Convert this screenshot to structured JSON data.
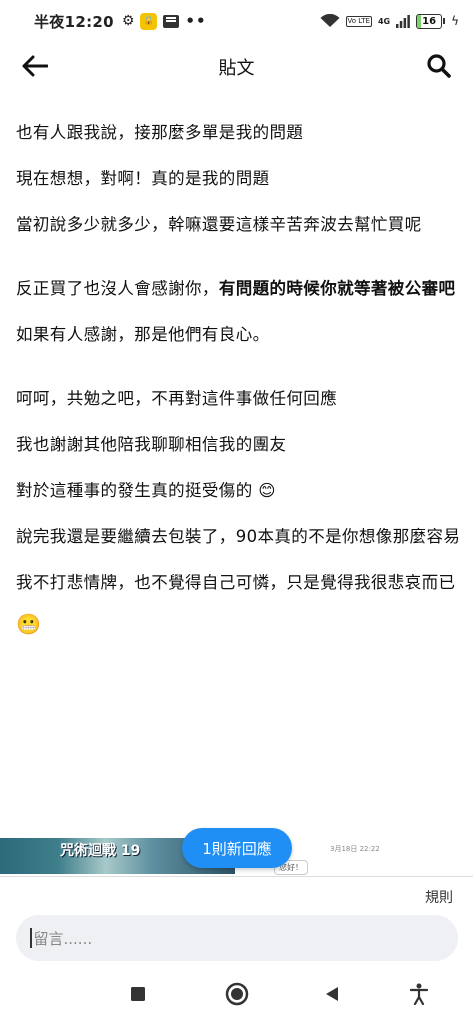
{
  "status_bar": {
    "time": "半夜12:20",
    "network": "4G",
    "lte": "Vo LTE",
    "battery": "16",
    "battery_level": 0.16,
    "more": "••"
  },
  "header": {
    "title": "貼文"
  },
  "post": {
    "p1": "也有人跟我說，接那麼多單是我的問題",
    "p2": "現在想想，對啊！真的是我的問題",
    "p3": "當初說多少就多少，幹嘛還要這樣辛苦奔波去幫忙買呢",
    "p4_normal": "反正買了也沒人會感謝你，",
    "p4_bold": "有問題的時候你就等著被公審吧",
    "p5": "如果有人感謝，那是他們有良心。",
    "p6": "呵呵，共勉之吧，不再對這件事做任何回應",
    "p7": "我也謝謝其他陪我聊聊相信我的團友",
    "p8": "對於這種事的發生真的挺受傷的 😊",
    "p9": "說完我還是要繼續去包裝了，90本真的不是你想像那麼容易",
    "p10": "我不打悲情牌，也不覺得自己可憐，只是覺得我很悲哀而已",
    "p11": "😬"
  },
  "preview": {
    "image_text": "咒術迴戰 19",
    "date": "3月18日 22:22",
    "greeting": "您好！"
  },
  "new_reply_pill": "1則新回應",
  "composer": {
    "rules": "規則",
    "placeholder": "留言......"
  },
  "colors": {
    "accent": "#1f8ff5",
    "battery": "#7ed26a",
    "input_bg": "#eef0f3"
  }
}
